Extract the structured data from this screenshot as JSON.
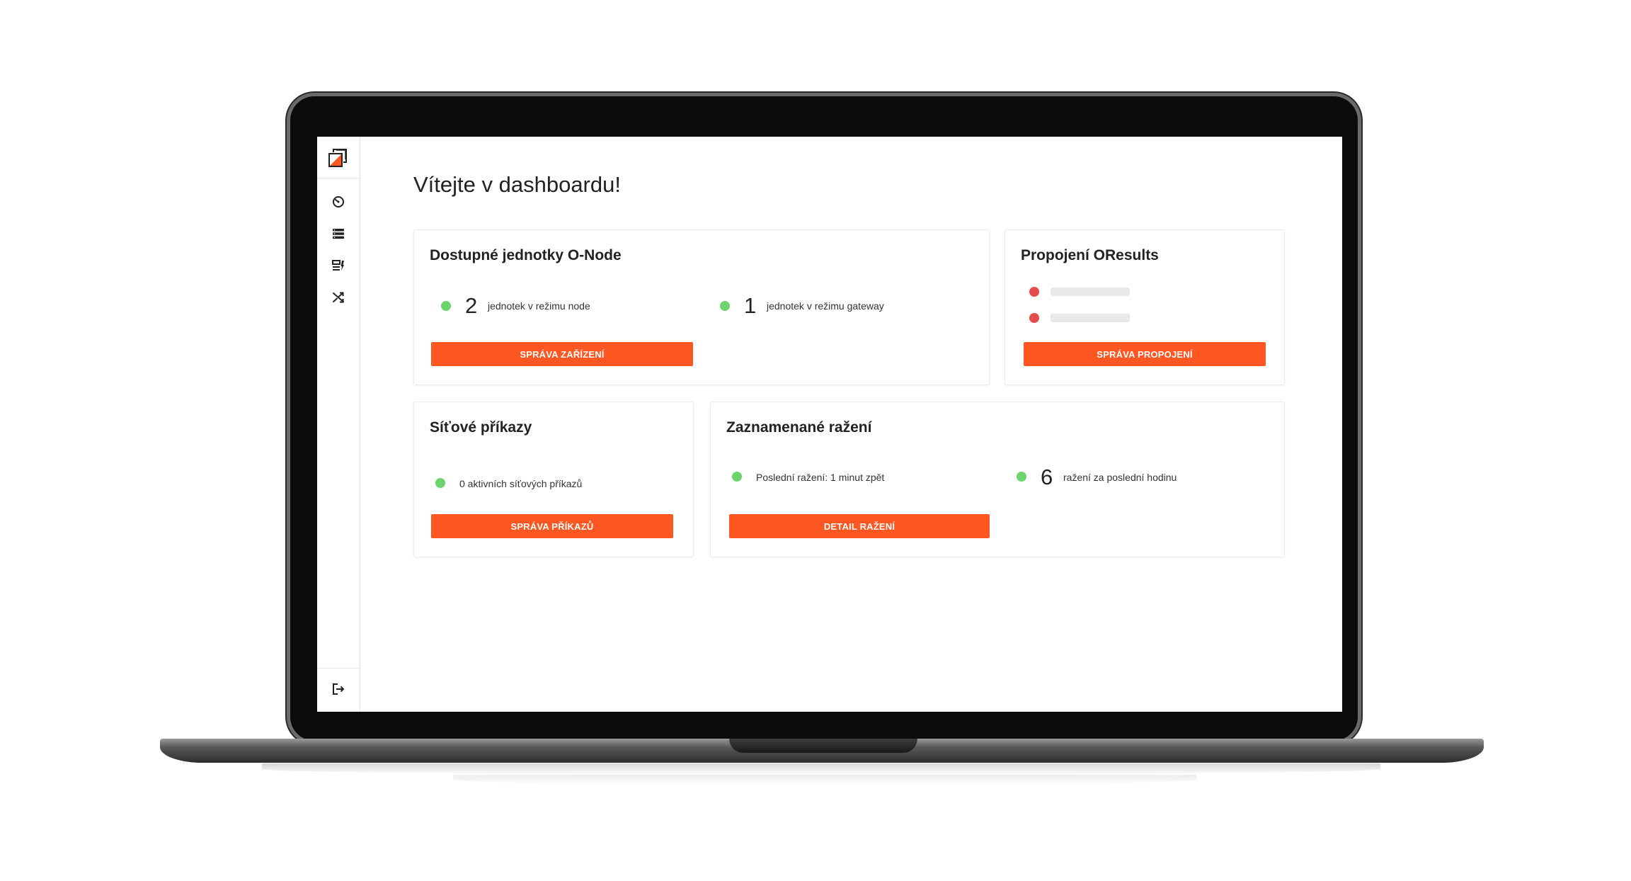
{
  "colors": {
    "accent": "#ff5722",
    "status_ok": "#6dd46d",
    "status_error": "#e54d4d"
  },
  "sidebar": {
    "logo_icon": "app-logo-icon",
    "items": [
      {
        "icon": "dashboard-gauge-icon"
      },
      {
        "icon": "server-list-icon"
      },
      {
        "icon": "commands-icon"
      },
      {
        "icon": "shuffle-icon"
      }
    ],
    "logout_icon": "logout-icon"
  },
  "main": {
    "title": "Vítejte v dashboardu!",
    "cards": {
      "units": {
        "title": "Dostupné jednotky O-Node",
        "node_count": "2",
        "node_label": "jednotek v režimu node",
        "gateway_count": "1",
        "gateway_label": "jednotek v režimu gateway",
        "button": "SPRÁVA ZAŘÍZENÍ"
      },
      "oresults": {
        "title": "Propojení OResults",
        "button": "SPRÁVA PROPOJENÍ"
      },
      "commands": {
        "title": "Síťové příkazy",
        "status_label": "0 aktivních síťových příkazů",
        "button": "SPRÁVA PŘÍKAZŮ"
      },
      "punches": {
        "title": "Zaznamenané ražení",
        "last_punch_label": "Poslední ražení: 1 minut zpět",
        "hour_count": "6",
        "hour_label": "ražení za poslední hodinu",
        "button": "DETAIL RAŽENÍ"
      }
    }
  }
}
